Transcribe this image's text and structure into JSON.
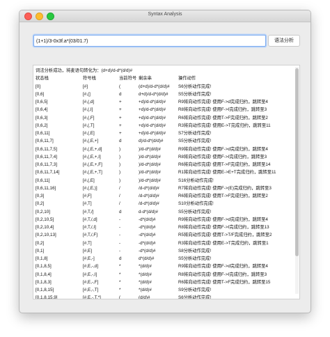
{
  "window": {
    "title": "Syntax Analysis"
  },
  "input": {
    "value": "(1+1)/3-0x3f.a*(03/01.7)"
  },
  "analyze_button": {
    "label": "语法分析"
  },
  "output": {
    "summary": "词法分析成功，将麦语句转化为：(d+d)/d-d*(d/d)#",
    "headers": [
      "状态栈",
      "符号栈",
      "当前符号",
      "剩余串",
      "操作动作"
    ],
    "rows": [
      [
        "[0]",
        "[#]",
        "(",
        "(d+d)/d-d*(d/d)#",
        "S6分析动作完成!"
      ],
      [
        "[0,6]",
        "[#,(]",
        "d",
        "d+d)/d-d*(d/d)#",
        "S5分析动作完成!"
      ],
      [
        "[0,6,5]",
        "[#,(,d]",
        "+",
        "+d)/d-d*(d/d)#",
        "R9将向动作完成! 使用F->d完成归约，跳转至4"
      ],
      [
        "[0,6,4]",
        "[#,(,I]",
        "+",
        "+d)/d-d*(d/d)#",
        "R8将向动作完成! 使用F->I完成归约，跳转至3"
      ],
      [
        "[0,6,3]",
        "[#,(,F]",
        "+",
        "+d)/d-d*(d/d)#",
        "R6将向动作完成! 使用T->F完成归约，跳转至2"
      ],
      [
        "[0,6,2]",
        "[#,(,T]",
        "+",
        "+d)/d-d*(d/d)#",
        "R3将向动作完成! 使用E->T完成归约，跳转至11"
      ],
      [
        "[0,6,11]",
        "[#,(,E]",
        "+",
        "+d)/d-d*(d/d)#",
        "S7分析动作完成!"
      ],
      [
        "[0,6,11,7]",
        "[#,(,E,+]",
        "d",
        "d)/d-d*(d/d)#",
        "S5分析动作完成!"
      ],
      [
        "[0,6,11,7,5]",
        "[#,(,E,+,d]",
        ")",
        ")/d-d*(d/d)#",
        "R9将向动作完成! 使用F->d完成归约，跳转至4"
      ],
      [
        "[0,6,11,7,4]",
        "[#,(,E,+,I]",
        ")",
        ")/d-d*(d/d)#",
        "R8将向动作完成! 使用F->I完成归约，跳转至3"
      ],
      [
        "[0,6,11,7,3]",
        "[#,(,E,+,F]",
        ")",
        ")/d-d*(d/d)#",
        "R6将向动作完成! 使用T->F完成归约，跳转至14"
      ],
      [
        "[0,6,11,7,14]",
        "[#,(,E,+,T]",
        ")",
        ")/d-d*(d/d)#",
        "R1将向动作完成! 使用E->E+T完成归约，跳转至11"
      ],
      [
        "[0,6,11]",
        "[#,(,E]",
        ")",
        ")/d-d*(d/d)#",
        "S16分析动作完成!"
      ],
      [
        "[0,6,11,16]",
        "[#,(,E,)]",
        "/",
        "/d-d*(d/d)#",
        "R7将向动作完成! 使用F->(E)完成归约，跳转至3"
      ],
      [
        "[0,3]",
        "[#,F]",
        "/",
        "/d-d*(d/d)#",
        "R6将向动作完成! 使用T->F完成归约，跳转至2"
      ],
      [
        "[0,2]",
        "[#,T]",
        "/",
        "/d-d*(d/d)#",
        "S10分析动作完成!"
      ],
      [
        "[0,2,10]",
        "[#,T,/]",
        "d",
        "d-d*(d/d)#",
        "S5分析动作完成!"
      ],
      [
        "[0,2,10,5]",
        "[#,T,/,d]",
        "-",
        "-d*(d/d)#",
        "R9将向动作完成! 使用F->d完成归约，跳转至4"
      ],
      [
        "[0,2,10,4]",
        "[#,T,/,I]",
        "-",
        "-d*(d/d)#",
        "R8将向动作完成! 使用F->I完成归约，跳转至13"
      ],
      [
        "[0,2,10,13]",
        "[#,T,/,F]",
        "-",
        "-d*(d/d)#",
        "R5将向动作完成! 使用T->T/F完成归约，跳转至2"
      ],
      [
        "[0,2]",
        "[#,T]",
        "-",
        "-d*(d/d)#",
        "R3将向动作完成! 使用E->T完成归约，跳转至1"
      ],
      [
        "[0,1]",
        "[#,E]",
        "-",
        "-d*(d/d)#",
        "S8分析动作完成!"
      ],
      [
        "[0,1,8]",
        "[#,E,-]",
        "d",
        "d*(d/d)#",
        "S5分析动作完成!"
      ],
      [
        "[0,1,8,5]",
        "[#,E,-,d]",
        "*",
        "*(d/d)#",
        "R9将向动作完成! 使用F->d完成归约，跳转至4"
      ],
      [
        "[0,1,8,4]",
        "[#,E,-,I]",
        "*",
        "*(d/d)#",
        "R8将向动作完成! 使用F->I完成归约，跳转至3"
      ],
      [
        "[0,1,8,3]",
        "[#,E,-,F]",
        "*",
        "*(d/d)#",
        "R6将向动作完成! 使用T->F完成归约，跳转至15"
      ],
      [
        "[0,1,8,15]",
        "[#,E,-,T]",
        "*",
        "*(d/d)#",
        "S9分析动作完成!"
      ],
      [
        "[0,1,8,15,9]",
        "[#,E,-,T,*]",
        "(",
        "(d/d)#",
        "S6分析动作完成!"
      ]
    ]
  }
}
